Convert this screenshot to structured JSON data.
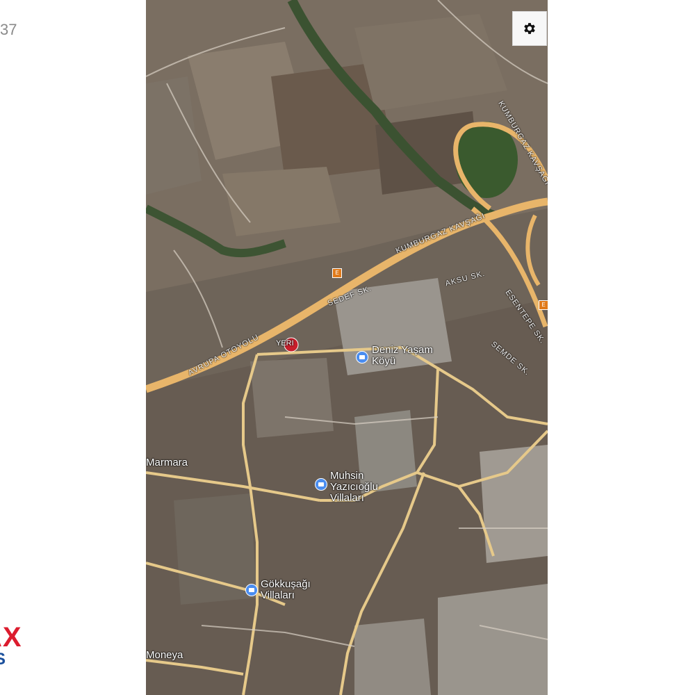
{
  "page": {
    "left_text": "37",
    "brand": {
      "line1": "AX",
      "line2": "S"
    }
  },
  "map": {
    "settings_icon": "gear-icon",
    "highways": [
      {
        "label": "AVRUPA OTOYOLU",
        "shield": "E"
      },
      {
        "label": "KUMBURGAZ KAVŞAĞI",
        "shield": "E"
      }
    ],
    "streets": [
      "KUMBURGAZ KAVŞAĞI",
      "SEDEF SK.",
      "AKSU SK.",
      "ESENTEPE SK.",
      "SEMDE SK."
    ],
    "pois": [
      {
        "name": "Deniz Yaşam Köyü",
        "icon": "building-icon"
      },
      {
        "name": "Muhsin Yazıcıoğlu Villaları",
        "icon": "building-icon"
      },
      {
        "name": "Gökkuşağı Villaları",
        "icon": "building-icon"
      }
    ],
    "areas": [
      "Marmara",
      "Moneya"
    ],
    "marker": {
      "label": "YERI",
      "icon": "location-marker-icon"
    },
    "colors": {
      "highway": "#e8b56a",
      "road": "#e7c98a",
      "terrain": "#6b6055",
      "poi": "#4a8df0",
      "marker": "#c81e2b"
    }
  }
}
